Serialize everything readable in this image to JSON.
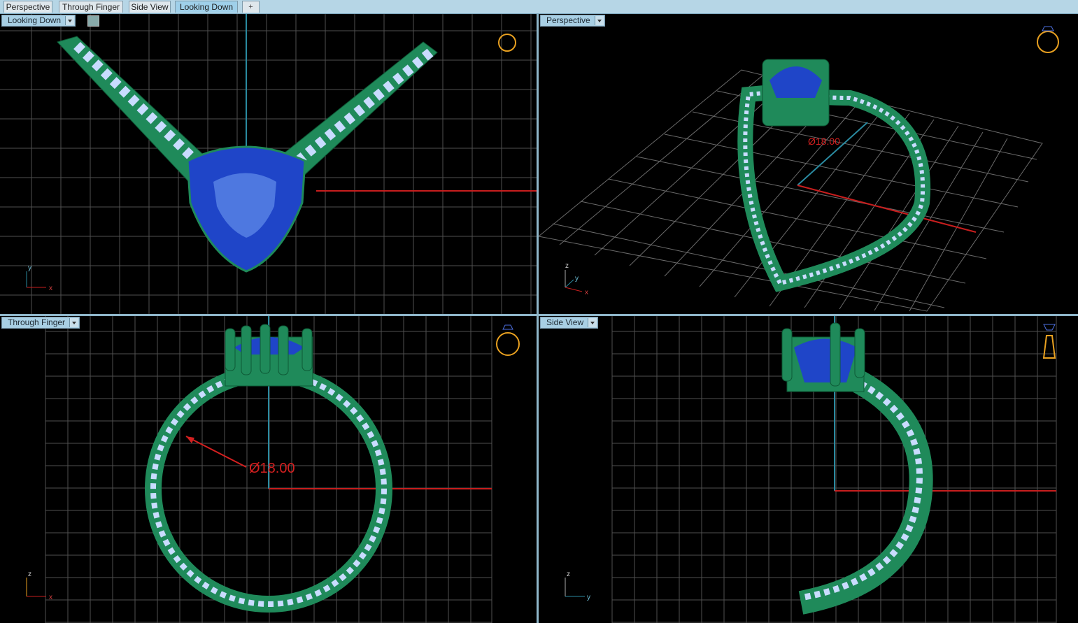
{
  "tabs": [
    {
      "label": "Perspective",
      "active": false
    },
    {
      "label": "Through Finger",
      "active": false
    },
    {
      "label": "Side View",
      "active": false
    },
    {
      "label": "Looking Down",
      "active": true
    },
    {
      "label": "+",
      "active": false
    }
  ],
  "viewports": {
    "top_left": {
      "label": "Looking Down",
      "axis_a": "y",
      "axis_b": "x"
    },
    "top_right": {
      "label": "Perspective",
      "axis_a": "z",
      "axis_b": "y",
      "axis_c": "x",
      "dimension": "Ø18.00"
    },
    "bottom_left": {
      "label": "Through Finger",
      "axis_a": "z",
      "axis_b": "x",
      "dimension": "Ø18.00"
    },
    "bottom_right": {
      "label": "Side View",
      "axis_a": "z",
      "axis_b": "y"
    }
  },
  "colors": {
    "metal": "#1f8a5a",
    "stone": "#1f45c8",
    "diamond": "#c9dcff",
    "grid": "#5a5a5a",
    "x_axis": "#c81e1e",
    "y_axis": "#2a8aa0",
    "dimension": "#d42020",
    "nav_icon": "#e8a020"
  },
  "icons": [
    "ring-view-cube-icon",
    "dropdown-arrow-icon",
    "add-tab-icon"
  ]
}
